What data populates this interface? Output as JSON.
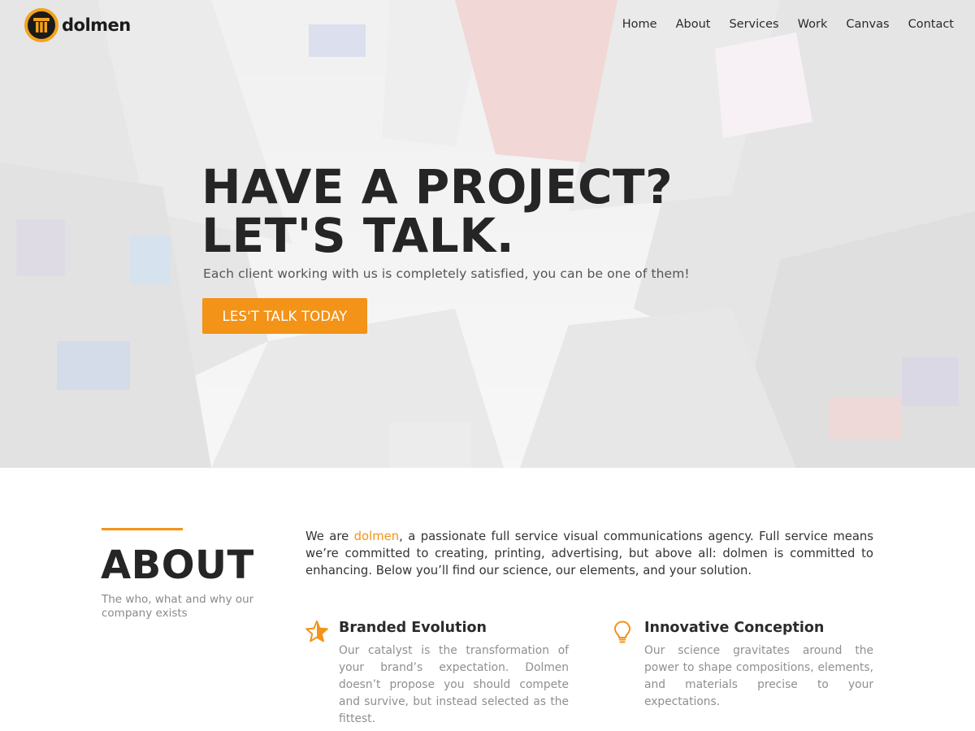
{
  "brand": {
    "name": "dolmen",
    "accent_color": "#f39318"
  },
  "nav": {
    "items": [
      {
        "label": "Home"
      },
      {
        "label": "About"
      },
      {
        "label": "Services"
      },
      {
        "label": "Work"
      },
      {
        "label": "Canvas"
      },
      {
        "label": "Contact"
      }
    ]
  },
  "hero": {
    "title_line1": "HAVE A PROJECT?",
    "title_line2": "LET'S TALK.",
    "subtitle": "Each client working with us is completely satisfied, you can be one of them!",
    "cta_label": "LES'T TALK TODAY",
    "background": "city-skyline-looking-up-photo"
  },
  "about": {
    "heading": "ABOUT",
    "tagline": "The who, what and why our company exists",
    "intro_before": "We are ",
    "intro_brand": "dolmen",
    "intro_after": ", a passionate full service visual communications agency. Full service means we’re committed to creating, printing, advertising, but above all: dolmen is committed to enhancing. Below you’ll find our science, our elements, and your solution.",
    "features": [
      {
        "icon": "star-icon",
        "title": "Branded Evolution",
        "text": "Our catalyst is the transformation of your brand’s expectation. Dolmen doesn’t propose you should compete and survive, but instead selected as the fittest."
      },
      {
        "icon": "lightbulb-icon",
        "title": "Innovative Conception",
        "text": "Our science gravitates around the power to shape compositions, elements, and materials precise to your expectations."
      }
    ]
  }
}
